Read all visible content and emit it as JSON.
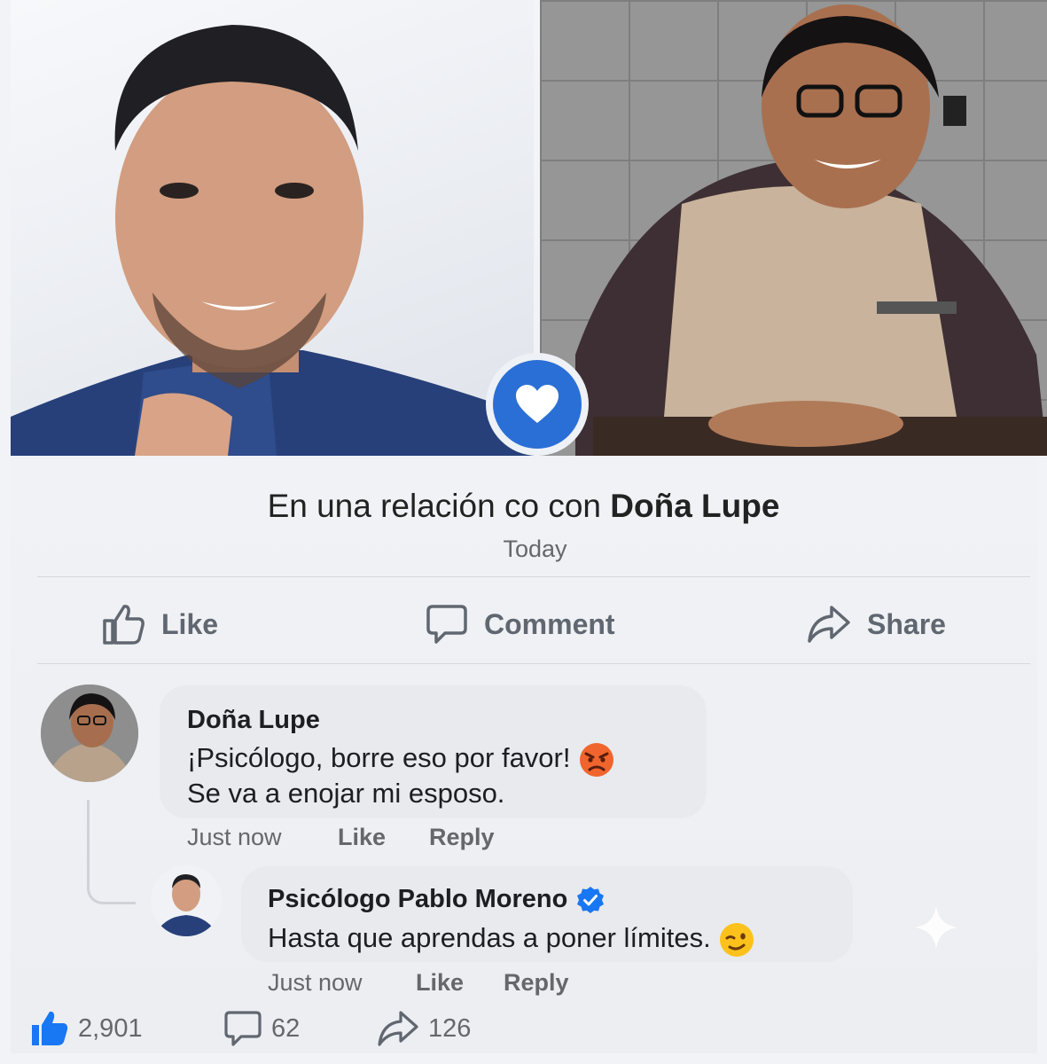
{
  "post": {
    "status_prefix": "En una relación co con ",
    "status_person": "Doña Lupe",
    "date": "Today"
  },
  "actions": {
    "like": "Like",
    "comment": "Comment",
    "share": "Share"
  },
  "comments": [
    {
      "author": "Doña Lupe",
      "line1": "¡Psicólogo, borre eso por favor!",
      "line2": "Se va a enojar mi esposo.",
      "time": "Just now",
      "like": "Like",
      "reply": "Reply"
    },
    {
      "author": "Psicólogo Pablo Moreno",
      "line1": "Hasta que aprendas a poner límites.",
      "time": "Just now",
      "like": "Like",
      "reply": "Reply"
    }
  ],
  "stats": {
    "likes": "2,901",
    "comments": "62",
    "shares": "126"
  },
  "colors": {
    "accent": "#2a6fd6",
    "verified": "#1877f2",
    "muted": "#65676b"
  },
  "icons": [
    "heart-icon",
    "thumbs-up-icon",
    "comment-icon",
    "share-icon",
    "verified-icon",
    "angry-emoji-icon",
    "wink-emoji-icon"
  ]
}
